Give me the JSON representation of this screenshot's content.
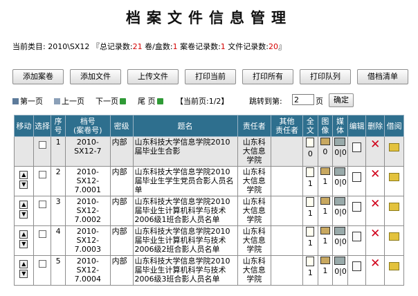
{
  "title": "档案文件信息管理",
  "stats": {
    "category_label": "当前类目:",
    "category_value": "2010\\SX12",
    "open_bracket": "『",
    "total_label": "总记录数:",
    "total_value": "21",
    "volumes_label": "卷/盒数:",
    "volumes_value": "1",
    "case_label": "案卷记录数:",
    "case_value": "1",
    "file_label": "文件记录数:",
    "file_value": "20",
    "close_bracket": "』"
  },
  "toolbar": [
    {
      "label": "添加案卷"
    },
    {
      "label": "添加文件"
    },
    {
      "label": "上传文件"
    },
    {
      "label": "打印当前"
    },
    {
      "label": "打印所有"
    },
    {
      "label": "打印队列"
    },
    {
      "label": "借档清单"
    }
  ],
  "pager": {
    "first": "第一页",
    "prev": "上一页",
    "next": "下一页",
    "last": "尾 页",
    "current_label": "【当前页:",
    "current_value": "1/2",
    "current_close": "】",
    "jump_label": "跳转到第:",
    "jump_value": "2",
    "page_unit": "页",
    "go_label": "确定"
  },
  "table": {
    "headers": [
      "移动",
      "选择",
      "序号",
      "档号\n(案卷号)",
      "密级",
      "题名",
      "责任者",
      "其他\n责任者",
      "全文",
      "图像",
      "媒体",
      "编辑",
      "删除",
      "借阅"
    ],
    "rows": [
      {
        "seq": "1",
        "code": "2010-SX12-7",
        "level": "内部",
        "title": "山东科技大学信息学院2010届毕业生合影",
        "author": "山东科大信息学院",
        "other": "",
        "fulltext": "0",
        "image": "0",
        "media": "0|0"
      },
      {
        "seq": "2",
        "code": "2010-SX12-7.0001",
        "level": "内部",
        "title": "山东科技大学信息学院2010届毕业生学生党员合影人员名单",
        "author": "山东科大信息学院",
        "other": "",
        "fulltext": "1",
        "image": "1",
        "media": "0|0"
      },
      {
        "seq": "3",
        "code": "2010-SX12-7.0002",
        "level": "内部",
        "title": "山东科技大学信息学院2010届毕业生计算机科学与技术2006级1班合影人员名单",
        "author": "山东科大信息学院",
        "other": "",
        "fulltext": "1",
        "image": "1",
        "media": "0|0"
      },
      {
        "seq": "4",
        "code": "2010-SX12-7.0003",
        "level": "内部",
        "title": "山东科技大学信息学院2010届毕业生计算机科学与技术2006级2班合影人员名单",
        "author": "山东科大信息学院",
        "other": "",
        "fulltext": "1",
        "image": "1",
        "media": "0|0"
      },
      {
        "seq": "5",
        "code": "2010-SX12-7.0004",
        "level": "内部",
        "title": "山东科技大学信息学院2010届毕业生计算机科学与技术2006级3班合影人员名单",
        "author": "山东科大信息学院",
        "other": "",
        "fulltext": "1",
        "image": "1",
        "media": "0|0"
      }
    ]
  },
  "icons": {
    "move_up": "up-arrow-icon",
    "move_down": "down-arrow-icon",
    "fulltext": "document-icon",
    "image": "image-icon",
    "media": "film-icon",
    "edit": "edit-icon",
    "delete": "delete-icon",
    "borrow": "borrow-folder-icon"
  },
  "colors": {
    "header_bg": "#2e6f8e",
    "stat_value": "#d40000",
    "delete": "#d0021b"
  }
}
